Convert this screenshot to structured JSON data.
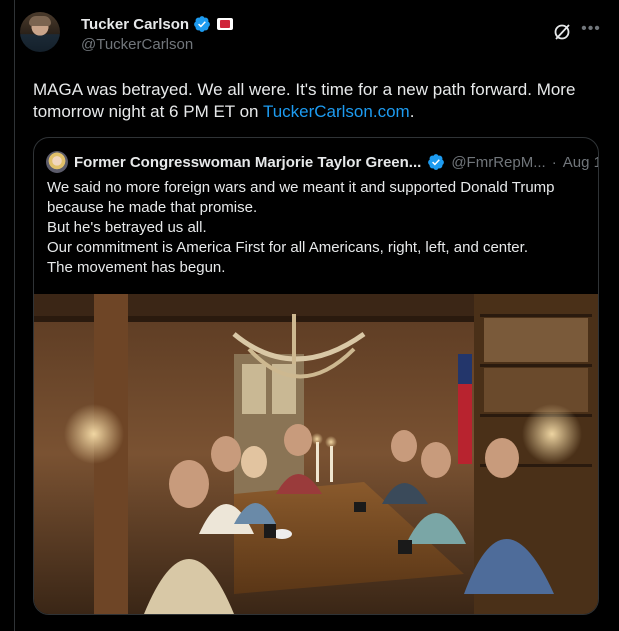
{
  "tweet": {
    "author_name": "Tucker Carlson",
    "author_handle": "@TuckerCarlson",
    "text_before_link": "MAGA was betrayed. We all were. It's time for a new path forward. More tomorrow night at 6 PM ET on ",
    "link_text": "TuckerCarlson.com",
    "text_after_link": "."
  },
  "quote": {
    "author_name": "Former Congresswoman Marjorie Taylor Green...",
    "author_handle": "@FmrRepM...",
    "separator": "·",
    "date": "Aug 1",
    "lines": [
      "We said no more foreign wars and we meant it and supported Donald Trump",
      "because he made that promise.",
      "But he's betrayed us all.",
      "Our commitment is America First for all Americans, right, left, and center.",
      "The movement has begun."
    ]
  },
  "icons": {
    "verified": "verified-badge-icon",
    "affiliation": "affiliation-badge-icon",
    "grok": "grok-icon",
    "more": "more-options-icon"
  },
  "colors": {
    "background": "#000000",
    "text": "#e7e9ea",
    "muted": "#71767b",
    "link": "#1d9bf0",
    "border": "#2f3336",
    "verified": "#1d9bf0"
  }
}
